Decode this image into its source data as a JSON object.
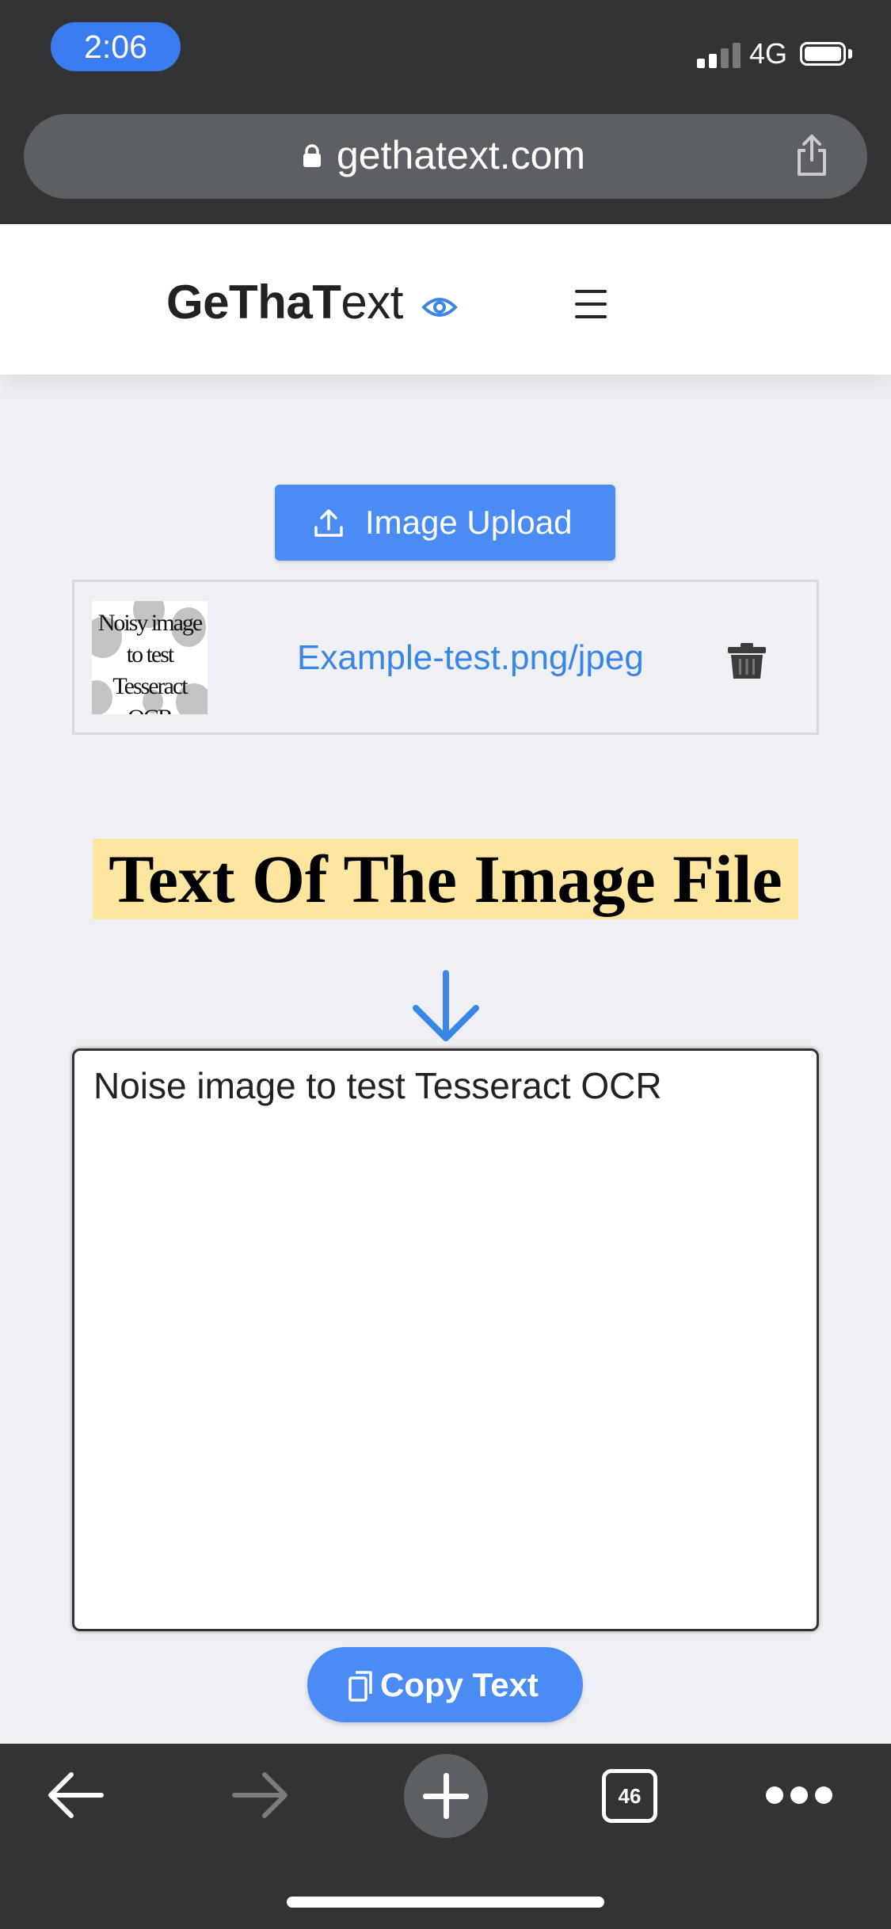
{
  "status_bar": {
    "time": "2:06",
    "network": "4G",
    "icons": [
      "signal-icon",
      "battery-icon"
    ]
  },
  "browser": {
    "url": "gethatext.com",
    "icons": [
      "lock-icon",
      "share-icon"
    ]
  },
  "site": {
    "logo_part1": "GeThaT",
    "logo_part2": "ext",
    "icons": [
      "eye-icon",
      "menu-icon"
    ]
  },
  "upload": {
    "button_label": "Image Upload",
    "icon": "upload-icon"
  },
  "file": {
    "thumbnail_text_lines": [
      "Noisy image",
      "to test",
      "Tesseract OCR"
    ],
    "name": "Example-test.png/jpeg",
    "icon": "trash-icon"
  },
  "result": {
    "heading": "Text Of The Image File",
    "text": "Noise image to test Tesseract OCR",
    "icon": "arrow-down-icon"
  },
  "copy": {
    "button_label": "Copy Text",
    "icon": "copy-icon"
  },
  "toolbar": {
    "tab_count": "46",
    "icons": [
      "back-icon",
      "forward-icon",
      "new-tab-icon",
      "tabs-icon",
      "more-icon"
    ]
  },
  "colors": {
    "chrome_bg": "#323335",
    "accent_blue": "#4a8cf3",
    "link_blue": "#3a86e6",
    "heading_highlight": "#fce59e",
    "page_bg": "#eef0f5"
  }
}
